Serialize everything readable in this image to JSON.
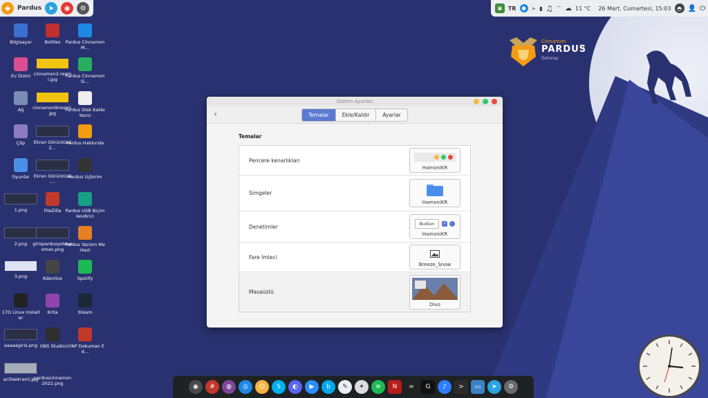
{
  "panel": {
    "left": {
      "label": "Pardus"
    },
    "right": {
      "keyboard": "TR",
      "weather": "11 °C",
      "datetime": "26 Mart, Cumartesi, 15:03"
    }
  },
  "desktop": {
    "icons": [
      {
        "label": "Bilgisayar",
        "icon": "computer-icon",
        "color": "#3b6fd0"
      },
      {
        "label": "Bottles",
        "icon": "bottles-icon",
        "color": "#c22f2f"
      },
      {
        "label": "Pardus Cinnamon M…",
        "icon": "music-icon",
        "color": "#1e88e5"
      },
      {
        "label": "Ev Dizini",
        "icon": "home-folder-icon",
        "color": "#d94e8f"
      },
      {
        "label": "cinnamon2.resmi.jpg",
        "icon": "image-thumb-icon",
        "color": "#f1c40f"
      },
      {
        "label": "Pardus Cinnamon Si…",
        "icon": "play-icon",
        "color": "#27ae60"
      },
      {
        "label": "Ağ",
        "icon": "network-icon",
        "color": "#7c8db5"
      },
      {
        "label": "cinnamonlkresmi.jpg",
        "icon": "image-thumb-icon",
        "color": "#f1c40f"
      },
      {
        "label": "Pardus Disk Kalıbı Yazıcı",
        "icon": "disk-writer-icon",
        "color": "#eeeeee"
      },
      {
        "label": "Çöp",
        "icon": "trash-icon",
        "color": "#8e7cc3"
      },
      {
        "label": "Ekran Görüntüsü 2…",
        "icon": "screenshot-thumb-icon",
        "color": "#2b2f45"
      },
      {
        "label": "Pardus Hakkında",
        "icon": "pardus-icon",
        "color": "#f39c12"
      },
      {
        "label": "Oyunlar",
        "icon": "folder-icon",
        "color": "#4a8fe7"
      },
      {
        "label": "Ekran Görüntüsü -…",
        "icon": "screenshot-thumb-icon",
        "color": "#2b2f45"
      },
      {
        "label": "Pardus Uçbirim",
        "icon": "terminal-icon",
        "color": "#333333"
      },
      {
        "label": "1.png",
        "icon": "screenshot-thumb-icon",
        "color": "#2b2f45"
      },
      {
        "label": "FileZilla",
        "icon": "filezilla-icon",
        "color": "#c0392b"
      },
      {
        "label": "Pardus USB Biçimlendirici",
        "icon": "usb-icon",
        "color": "#16a085"
      },
      {
        "label": "2.png",
        "icon": "screenshot-thumb-icon",
        "color": "#2b2f45"
      },
      {
        "label": "girispardusyolouosman.png",
        "icon": "screenshot-thumb-icon",
        "color": "#2b2f45"
      },
      {
        "label": "Pardus Yazılım Merkezi",
        "icon": "software-center-icon",
        "color": "#e67e22"
      },
      {
        "label": "3.png",
        "icon": "image-thumb-icon",
        "color": "#dde3f0"
      },
      {
        "label": "Kdenlive",
        "icon": "kdenlive-icon",
        "color": "#444444"
      },
      {
        "label": "Spotify",
        "icon": "spotify-icon",
        "color": "#1db954"
      },
      {
        "label": "17G Linux Installer",
        "icon": "installer-icon",
        "color": "#222222"
      },
      {
        "label": "Krita",
        "icon": "krita-icon",
        "color": "#8e44ad"
      },
      {
        "label": "Steam",
        "icon": "steam-icon",
        "color": "#1b2838"
      },
      {
        "label": "aaaaagiris.png",
        "icon": "screenshot-thumb-icon",
        "color": "#2b2f45"
      },
      {
        "label": "OBS Studio",
        "icon": "obs-icon",
        "color": "#302e31"
      },
      {
        "label": "UYAP Dokuman Ed…",
        "icon": "uyap-icon",
        "color": "#c0392b"
      },
      {
        "label": "acilisekranii.jpg",
        "icon": "screenshot-thumb-icon",
        "color": "#a6acb8"
      },
      {
        "label": "parduscinnamon2022.png",
        "icon": "image-thumb-icon",
        "color": "#2a3170"
      }
    ]
  },
  "logo": {
    "line1": "Cinnamon",
    "line2": "PARDUS",
    "num": "21",
    "line3": "Dolunay"
  },
  "window": {
    "title": "Sistem Ayarları",
    "tabs": [
      "Temalar",
      "Ekle/Kaldır",
      "Ayarlar"
    ],
    "section": "Temalar",
    "rows": [
      {
        "label": "Pencere kenarlıkları",
        "value": "HamoniKR"
      },
      {
        "label": "Simgeler",
        "value": "HamoniKR"
      },
      {
        "label": "Denetimler",
        "value": "HamoniKR",
        "button": "Button"
      },
      {
        "label": "Fare İmleci",
        "value": "Breeze_Snow"
      },
      {
        "label": "Masaüstü",
        "value": "Divo"
      }
    ]
  },
  "dock": {
    "items": [
      {
        "name": "chrome-icon",
        "color": "#4a4a4a",
        "glyph": "◉"
      },
      {
        "name": "grid-app-icon",
        "color": "#c0392b",
        "glyph": "#"
      },
      {
        "name": "tor-icon",
        "color": "#7d4698",
        "glyph": "◍"
      },
      {
        "name": "safari-like-icon",
        "color": "#1e88e5",
        "glyph": "◎"
      },
      {
        "name": "bounty-icon",
        "color": "#f5b342",
        "glyph": "☺"
      },
      {
        "name": "skype-icon",
        "color": "#00aff0",
        "glyph": "S"
      },
      {
        "name": "discord-icon",
        "color": "#5865f2",
        "glyph": "◐"
      },
      {
        "name": "zoom-icon",
        "color": "#2d8cff",
        "glyph": "▶"
      },
      {
        "name": "bip-icon",
        "color": "#00a8e8",
        "glyph": "b"
      },
      {
        "name": "notes-icon",
        "color": "#e8eef2",
        "glyph": "✎"
      },
      {
        "name": "avidemux-icon",
        "color": "#dddddd",
        "glyph": "✦"
      },
      {
        "name": "spotify-dock-icon",
        "color": "#1db954",
        "glyph": "≋"
      },
      {
        "name": "netflix-icon",
        "color": "#b71c1c",
        "glyph": "N"
      },
      {
        "name": "vlc-icon",
        "color": "#222222",
        "glyph": "∞"
      },
      {
        "name": "gain-icon",
        "color": "#111111",
        "glyph": "G"
      },
      {
        "name": "voice-icon",
        "color": "#2d7df6",
        "glyph": "♪"
      },
      {
        "name": "terminal-dock-icon",
        "color": "#2b2b2b",
        "glyph": ">"
      },
      {
        "name": "screen-icon",
        "color": "#3b82c4",
        "glyph": "▭"
      },
      {
        "name": "telegram-icon",
        "color": "#2aa3e0",
        "glyph": "➤"
      },
      {
        "name": "settings-icon",
        "color": "#6b6b6b",
        "glyph": "⚙"
      }
    ]
  },
  "colors": {
    "accent": "#5a7bd1",
    "wallpaper": "#2a3170",
    "close": "#e74c3c",
    "max": "#2ecc71",
    "min": "#f5b942"
  }
}
